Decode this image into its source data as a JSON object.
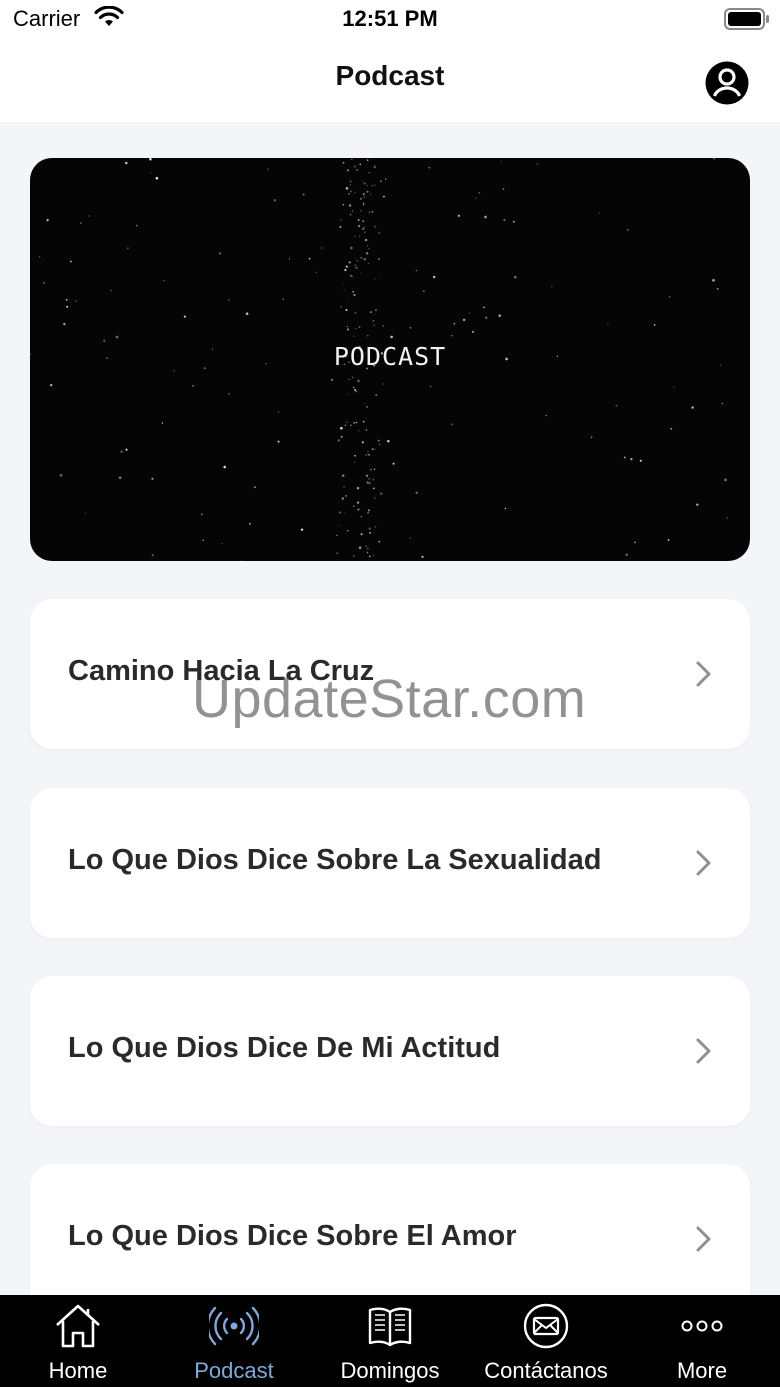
{
  "status_bar": {
    "carrier": "Carrier",
    "time": "12:51 PM"
  },
  "nav": {
    "title": "Podcast"
  },
  "hero": {
    "title": "PODCAST"
  },
  "podcasts": [
    {
      "title": "Camino Hacia La Cruz"
    },
    {
      "title": "Lo Que Dios Dice Sobre La Sexualidad"
    },
    {
      "title": "Lo Que Dios Dice De Mi Actitud"
    },
    {
      "title": "Lo Que Dios Dice Sobre El Amor"
    }
  ],
  "watermark": "UpdateStar.com",
  "tabs": [
    {
      "label": "Home",
      "icon": "home-icon"
    },
    {
      "label": "Podcast",
      "icon": "broadcast-icon",
      "active": true
    },
    {
      "label": "Domingos",
      "icon": "book-icon"
    },
    {
      "label": "Contáctanos",
      "icon": "mail-icon"
    },
    {
      "label": "More",
      "icon": "more-icon"
    }
  ],
  "colors": {
    "accent": "#7fa8de",
    "tab_bg": "#000000",
    "page_bg": "#f3f5f9"
  }
}
